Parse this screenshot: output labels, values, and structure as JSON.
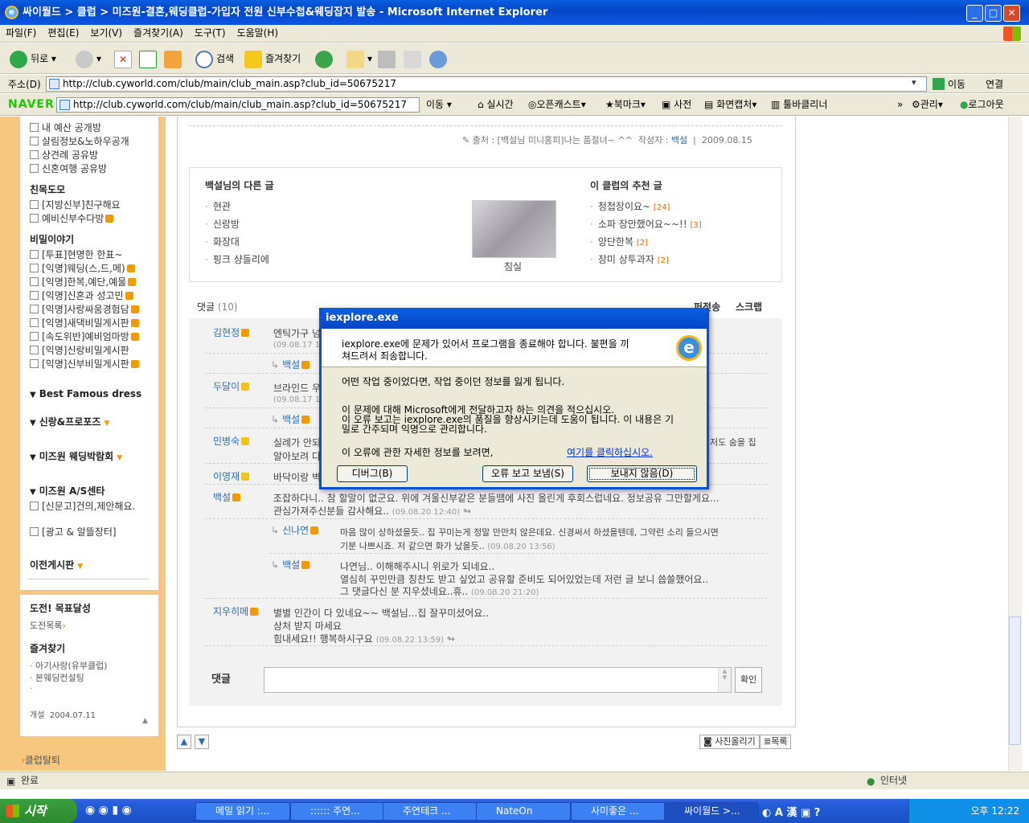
{
  "window": {
    "title": "싸이월드 > 클럽 > 미즈원-결혼,웨딩클럽-가입자 전원 신부수첩&웨딩잡지 발송 - Microsoft Internet Explorer"
  },
  "menu": [
    "파일(F)",
    "편집(E)",
    "보기(V)",
    "즐겨찾기(A)",
    "도구(T)",
    "도움말(H)"
  ],
  "toolbar": {
    "back": "뒤로",
    "search": "검색",
    "favorites": "즐겨찾기"
  },
  "address": {
    "label": "주소(D)",
    "url": "http://club.cyworld.com/club/main/club_main.asp?club_id=50675217",
    "go": "이동",
    "links": "연결"
  },
  "naver": {
    "logo": "NAVER",
    "url": "http://club.cyworld.com/club/main/club_main.asp?club_id=50675217",
    "go": "이동",
    "items": [
      "실시간",
      "오픈캐스트",
      "북마크",
      "사전",
      "화면캡처",
      "툴바클리너",
      "관리",
      "로그아웃"
    ]
  },
  "sidebar": {
    "menu1": [
      "내 예산 공개방",
      "살림정보&노하우공개",
      "상견례 공유방",
      "신혼여행 공유방"
    ],
    "group1": "친목도모",
    "menu2": [
      "[지방신부]친구해요",
      "예비신부수다방"
    ],
    "group2": "비밀이야기",
    "menu3": [
      "[투표]현명한 한표~",
      "[익명]웨딩(스,드,메)",
      "[익명]한복,예단,예물",
      "[익명]신혼과 성고민",
      "[익명]사랑싸움경험담",
      "[익명]새댁비밀게시판",
      "[속도위반]예비엄마방",
      "[익명]신랑비밀게시판",
      "[익명]신부비밀게시판"
    ],
    "group3": "Best Famous dress",
    "group4": "신랑&프로포즈",
    "group5": "미즈원 웨딩박람회",
    "group6": "미즈원 A/S센타",
    "menu4": "[신문고]건의,제안해요.",
    "menu5": "[광고 & 알뜰장터]",
    "group7": "이전게시판",
    "challenge": "도전! 목표달성",
    "challenge_list": "도전목록",
    "favorites": "즐겨찾기",
    "fav_items": [
      "아기사랑(유부클럽)",
      "본웨딩컨설팅"
    ],
    "opened_label": "개설",
    "opened_date": "2004.07.11",
    "leave": "클럽탈퇴"
  },
  "post": {
    "source_label": "출처 :",
    "source": "[백설님 미니홈피]나는 품절녀~ ^^",
    "author_label": "작성자 :",
    "author": "백설",
    "date": "2009.08.15"
  },
  "related": {
    "other_title": "백설님의 다른 글",
    "other_posts": [
      "현관",
      "신랑방",
      "화장대",
      "핑크 샹들리에"
    ],
    "image_caption": "침실",
    "rec_title": "이 클럽의 추천 글",
    "rec_posts": [
      {
        "title": "청첩장이요~",
        "count": "[24]"
      },
      {
        "title": "소파 장만했어요~~!!",
        "count": "[3]"
      },
      {
        "title": "양단한복",
        "count": "[2]"
      },
      {
        "title": "장미 상투과자",
        "count": "[2]"
      }
    ]
  },
  "comments": {
    "label": "댓글",
    "count": "(10)",
    "forward": "퍼전송",
    "scrap": "스크랩",
    "items": [
      {
        "name": "김현정",
        "text": "엔틱가구 넘",
        "date": "(09.08.17 11"
      },
      {
        "name": "백설",
        "reply": true
      },
      {
        "name": "두달이",
        "text": "브라인드 우",
        "date": "(09.08.17 12"
      },
      {
        "name": "백설",
        "reply": true
      },
      {
        "name": "민병숙",
        "text": "실례가 안되",
        "text2": "알아보려 다",
        "tail": "저도 숨을 집"
      },
      {
        "name": "이영재",
        "text": "바닥이랑 벽"
      },
      {
        "name": "백설",
        "text": "조잡하다니.. 참 할말이 없군요. 위에 겨울신부같은 분들땜에 사진 올린게 후회스럽네요. 정보공유 그만할게요...",
        "text2": "관심가져주신분들 감사해요..",
        "date": "(09.08.20 12:40)"
      },
      {
        "name": "신나연",
        "text": "마음 많이 상하셨을듯.. 집 꾸미는게 정말 만만치 않은데요. 신경써서 하셨을텐데, 그약런 소리 들으시면",
        "text2": "기분 나쁘시죠. 저 같으면 화가 났을듯..",
        "date": "(09.08.20 13:56)"
      },
      {
        "name": "백설",
        "text": "나연님.. 이해해주시니 위로가 되네요..",
        "text2": "열심히 꾸민만큼 칭찬도 받고 싶었고 공유할 준비도 되어있었는데 저런 글 보니 씁쓸했어요..",
        "text3": "그 댓글다신 분 지우셨네요..휴..",
        "date": "(09.08.20 21:20)"
      },
      {
        "name": "지우히메",
        "text": "별별 인간이 다 있네요~~ 백설님...집 잘꾸미셨어요..",
        "text2": "상처 받지 마세요",
        "text3": "힘내세요!! 행복하시구요",
        "date": "(09.08.22 13:59)"
      }
    ],
    "input_label": "댓글",
    "confirm": "확인"
  },
  "bottom": {
    "upload_photo": "사진올리기",
    "list": "목록"
  },
  "dialog": {
    "title": "iexplore.exe",
    "line1": "iexplore.exe에 문제가 있어서 프로그램을 종료해야 합니다. 불편을 끼",
    "line1b": "쳐드려서 죄송합니다.",
    "line2": "어떤 작업 중이었다면, 작업 중이던 정보를 잃게 됩니다.",
    "line3": "이 문제에 대해 Microsoft에게 전달하고자 하는 의견을 적으십시오.",
    "line4": "이 오류 보고는 iexplore.exe의 품질을 향상시키는데 도움이 됩니다. 이 내용은 기",
    "line4b": "밀로 간주되며 익명으로 관리합니다.",
    "line5": "이 오류에 관한 자세한 정보를 보려면,",
    "link": "여기를 클릭하십시오.",
    "debug": "디버그(B)",
    "send": "오류 보고 보냄(S)",
    "dont_send": "보내지 않음(D)"
  },
  "status": {
    "left": "완료",
    "zone": "인터넷"
  },
  "taskbar": {
    "start": "시작",
    "tasks": [
      "메일 읽기 :...",
      ":::::: 주연...",
      "주연테크 ...",
      "NateOn",
      "사미좋은 ...",
      "싸이월드 >..."
    ],
    "clock": "오후 12:22"
  }
}
